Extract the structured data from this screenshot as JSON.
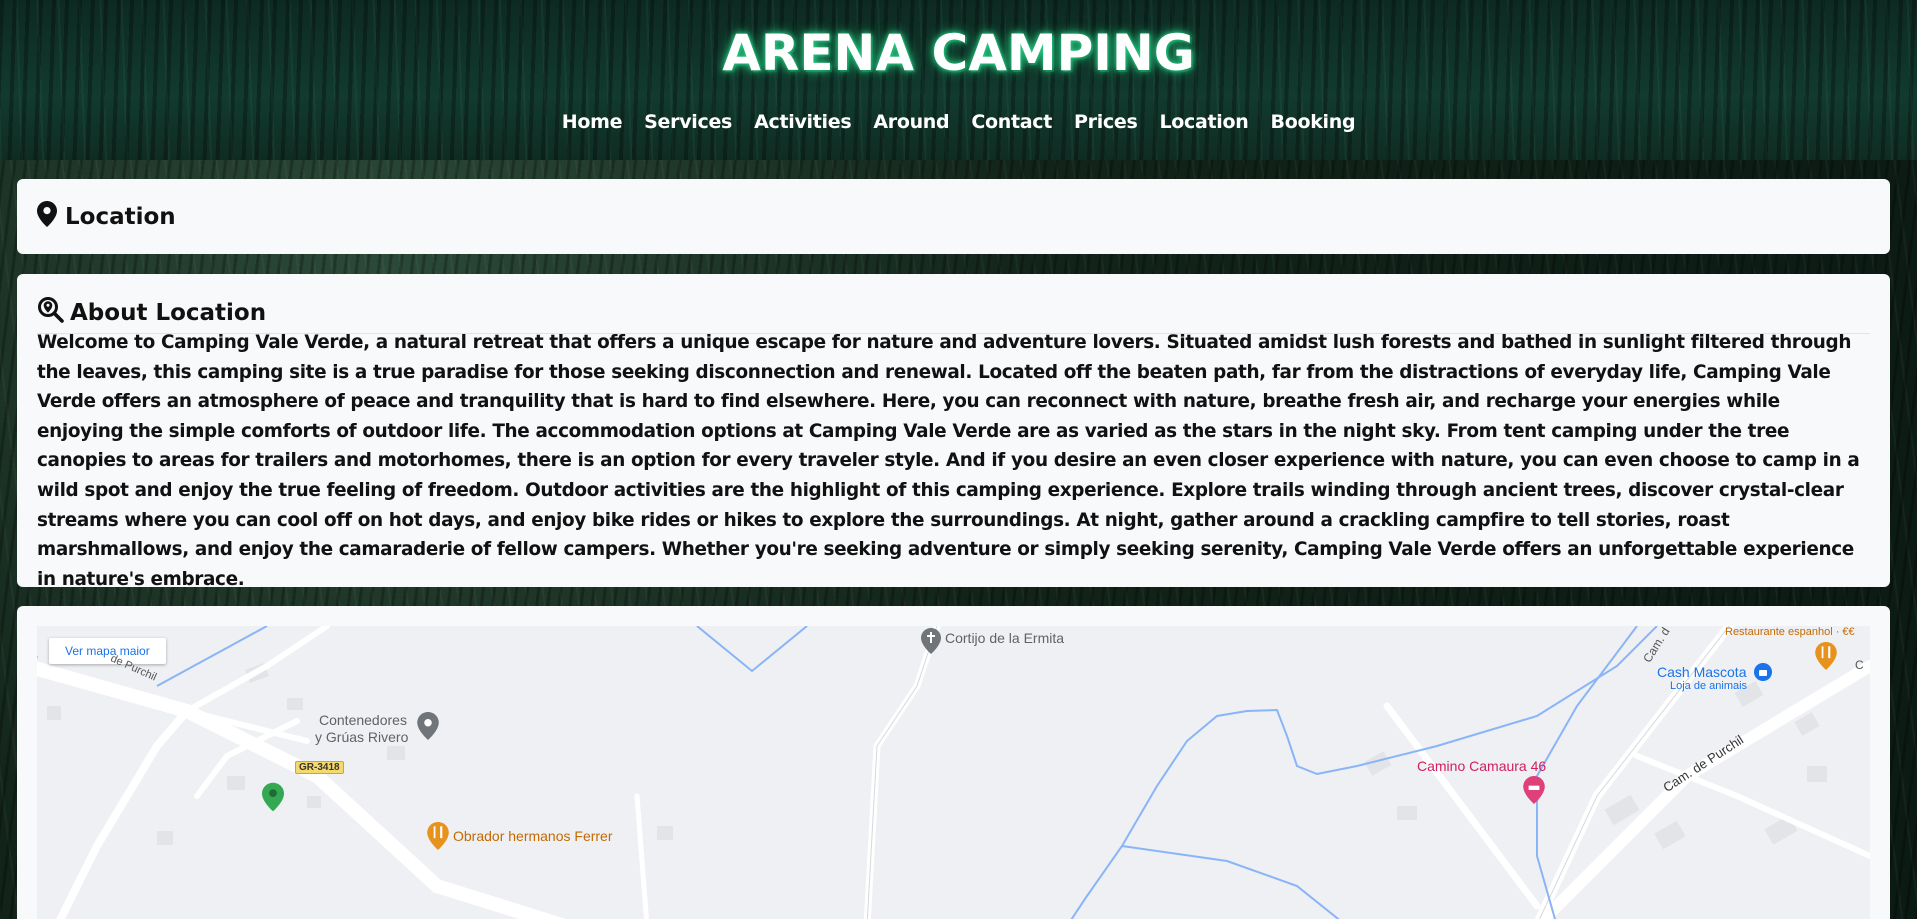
{
  "site": {
    "title": "ARENA CAMPING"
  },
  "nav": [
    "Home",
    "Services",
    "Activities",
    "Around",
    "Contact",
    "Prices",
    "Location",
    "Booking"
  ],
  "location_card": {
    "title": "Location",
    "icon": "map-pin-icon"
  },
  "about": {
    "title": "About Location",
    "icon": "search-location-icon",
    "text": "Welcome to Camping Vale Verde, a natural retreat that offers a unique escape for nature and adventure lovers. Situated amidst lush forests and bathed in sunlight filtered through the leaves, this camping site is a true paradise for those seeking disconnection and renewal. Located off the beaten path, far from the distractions of everyday life, Camping Vale Verde offers an atmosphere of peace and tranquility that is hard to find elsewhere. Here, you can reconnect with nature, breathe fresh air, and recharge your energies while enjoying the simple comforts of outdoor life. The accommodation options at Camping Vale Verde are as varied as the stars in the night sky. From tent camping under the tree canopies to areas for trailers and motorhomes, there is an option for every traveler style. And if you desire an even closer experience with nature, you can even choose to camp in a wild spot and enjoy the true feeling of freedom. Outdoor activities are the highlight of this camping experience. Explore trails winding through ancient trees, discover crystal-clear streams where you can cool off on hot days, and enjoy bike rides or hikes to explore the surroundings. At night, gather around a crackling campfire to tell stories, roast marshmallows, and enjoy the camaraderie of fellow campers. Whether you're seeking adventure or simply seeking serenity, Camping Vale Verde offers an unforgettable experience in nature's embrace."
  },
  "map": {
    "larger_map_label": "Ver mapa maior",
    "places": {
      "cortijo": "Cortijo de la Ermita",
      "contenedores_1": "Contenedores",
      "contenedores_2": "y Grúas Rivero",
      "road_badge": "GR-3418",
      "obrador": "Obrador hermanos Ferrer",
      "restaurante": "Restaurante espanhol · €€",
      "cash_mascota": "Cash Mascota",
      "cash_mascota_sub": "Loja de animais",
      "camino": "Camino Camaura 46",
      "street_purchil_left": "de Purchil",
      "street_purchil_right": "Cam. de Purchil",
      "street_cam": "Cam. d",
      "street_c": "C"
    },
    "colors": {
      "food_pin": "#e8921e",
      "lodging_pin": "#e0407a",
      "place_pin": "#70757a",
      "shop_pin": "#1a73e8",
      "green_pin": "#34a853",
      "water": "#8ab4f8"
    }
  }
}
